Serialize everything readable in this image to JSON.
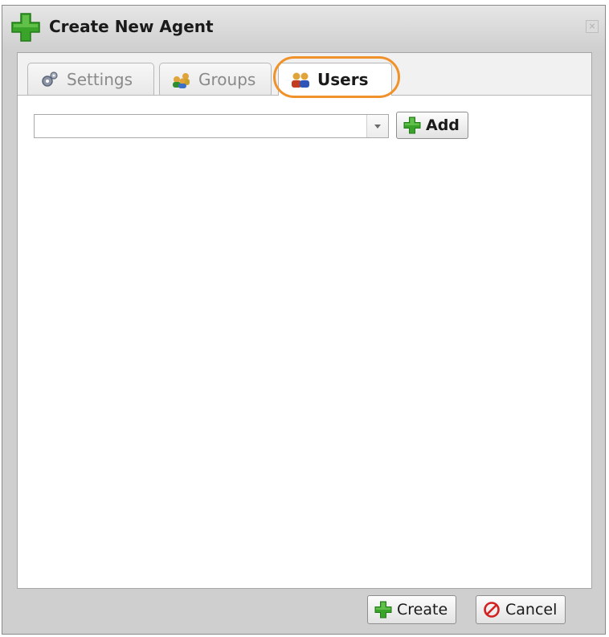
{
  "dialog": {
    "title": "Create New Agent",
    "close_icon": "close-icon"
  },
  "tabs": [
    {
      "label": "Settings",
      "icon": "gears-icon",
      "active": false
    },
    {
      "label": "Groups",
      "icon": "group-icon",
      "active": false
    },
    {
      "label": "Users",
      "icon": "users-icon",
      "active": true
    }
  ],
  "users_panel": {
    "select_value": "",
    "add_label": "Add"
  },
  "footer": {
    "create_label": "Create",
    "cancel_label": "Cancel"
  },
  "colors": {
    "highlight": "#f0922b",
    "plus_green": "#3aa32a",
    "cancel_red": "#d32020"
  }
}
